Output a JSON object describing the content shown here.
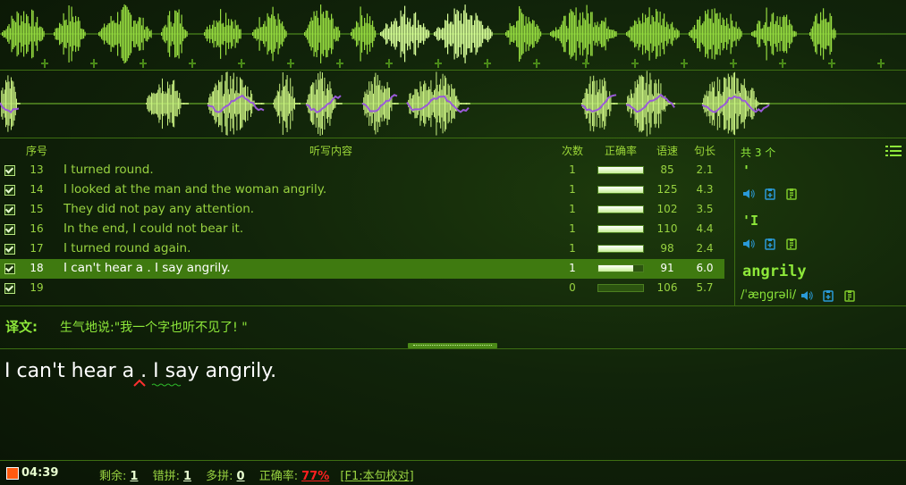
{
  "table": {
    "headers": {
      "index": "序号",
      "content": "听写内容",
      "count": "次数",
      "accuracy": "正确率",
      "speed": "语速",
      "length": "句长"
    },
    "rows": [
      {
        "index": "13",
        "text": "I turned round.",
        "count": "1",
        "accuracy": 1.0,
        "speed": "85",
        "length": "2.1",
        "selected": false
      },
      {
        "index": "14",
        "text": "I looked at the man and the woman angrily.",
        "count": "1",
        "accuracy": 1.0,
        "speed": "125",
        "length": "4.3",
        "selected": false
      },
      {
        "index": "15",
        "text": "They did not pay any attention.",
        "count": "1",
        "accuracy": 1.0,
        "speed": "102",
        "length": "3.5",
        "selected": false
      },
      {
        "index": "16",
        "text": "In the end, I could not bear it.",
        "count": "1",
        "accuracy": 1.0,
        "speed": "110",
        "length": "4.4",
        "selected": false
      },
      {
        "index": "17",
        "text": "I turned round again.",
        "count": "1",
        "accuracy": 1.0,
        "speed": "98",
        "length": "2.4",
        "selected": false
      },
      {
        "index": "18",
        "text": "I can't hear a . I say angrily.",
        "count": "1",
        "accuracy": 0.77,
        "speed": "91",
        "length": "6.0",
        "selected": true
      },
      {
        "index": "19",
        "text": "",
        "count": "0",
        "accuracy": 0,
        "speed": "106",
        "length": "5.7",
        "selected": false
      }
    ]
  },
  "words": {
    "total_label": "共 3 个",
    "items": [
      {
        "word": "'",
        "phonetic": ""
      },
      {
        "word": "'I",
        "phonetic": ""
      },
      {
        "word": "angrily",
        "phonetic": "/ˈæŋɡrəli/"
      }
    ]
  },
  "translation": {
    "label": "译文:",
    "text": "生气地说:\"我一个字也听不见了! \""
  },
  "input": {
    "text": "I can't hear a . I say angrily."
  },
  "status": {
    "time": "04:39",
    "remaining_label": "剩余:",
    "remaining": "1",
    "misspell_label": "错拼:",
    "misspell": "1",
    "extra_label": "多拼:",
    "extra": "0",
    "accuracy_label": "正确率:",
    "accuracy": "77%",
    "check_link": "[F1:本句校对]"
  },
  "colors": {
    "accent": "#8ee83a",
    "selected_row": "#3f7a10",
    "error": "#ff2020",
    "wave": "#b8f060"
  }
}
